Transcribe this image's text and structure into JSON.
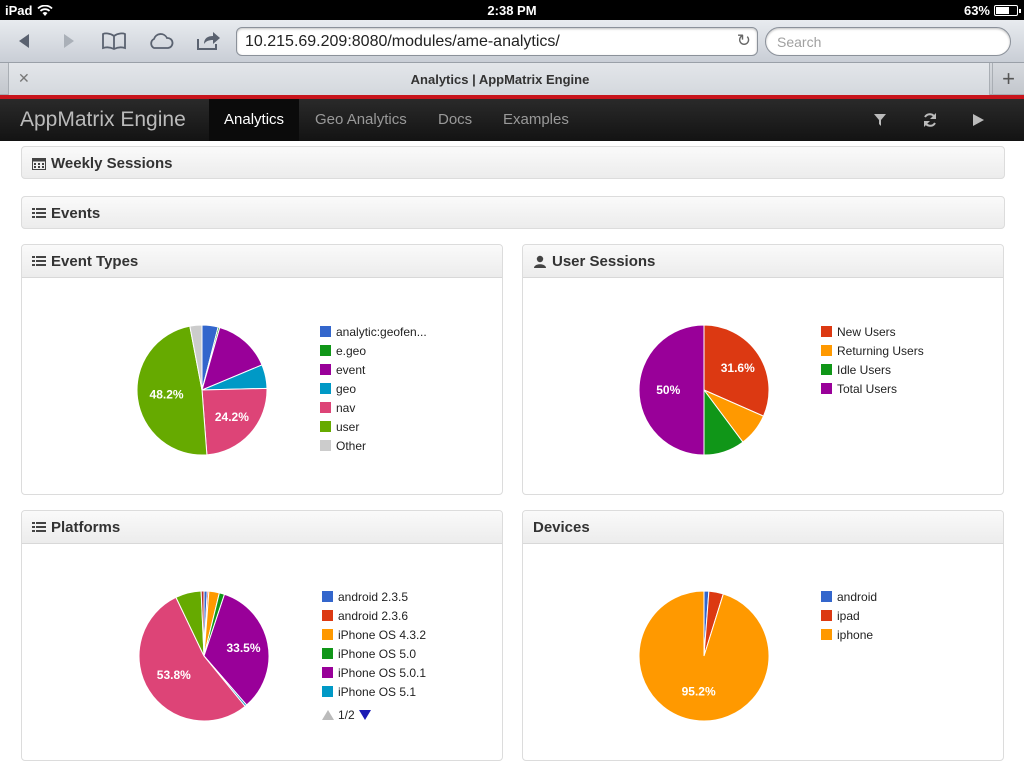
{
  "status": {
    "device": "iPad",
    "time": "2:38 PM",
    "battery": "63%",
    "battery_level": 0.63
  },
  "browser": {
    "url": "10.215.69.209:8080/modules/ame-analytics/",
    "search_placeholder": "Search",
    "tab_title": "Analytics | AppMatrix Engine"
  },
  "app": {
    "brand": "AppMatrix Engine",
    "nav": [
      "Analytics",
      "Geo Analytics",
      "Docs",
      "Examples"
    ],
    "active_nav": "Analytics"
  },
  "panels": {
    "weekly_sessions": "Weekly Sessions",
    "events": "Events",
    "event_types": "Event Types",
    "user_sessions": "User Sessions",
    "platforms": "Platforms",
    "devices": "Devices"
  },
  "pager": {
    "label": "1/2"
  },
  "chart_data": [
    {
      "type": "pie",
      "title": "Event Types",
      "labels": [
        "analytic:geofen...",
        "e.geo",
        "event",
        "geo",
        "nav",
        "user",
        "Other"
      ],
      "values": [
        4.0,
        0.4,
        14.3,
        5.9,
        24.2,
        48.2,
        3.0
      ],
      "colors": [
        "#3366cc",
        "#109618",
        "#990099",
        "#0099c6",
        "#dd4477",
        "#66aa00",
        "#cccccc"
      ],
      "slice_labels": [
        "",
        "",
        "",
        "",
        "24.2%",
        "48.2%",
        ""
      ]
    },
    {
      "type": "pie",
      "title": "User Sessions",
      "labels": [
        "New Users",
        "Returning Users",
        "Idle Users",
        "Total Users"
      ],
      "values": [
        31.6,
        8.2,
        10.2,
        50.0
      ],
      "colors": [
        "#dc3912",
        "#ff9900",
        "#109618",
        "#990099"
      ],
      "slice_labels": [
        "31.6%",
        "",
        "",
        "50%"
      ]
    },
    {
      "type": "pie",
      "title": "Platforms",
      "labels": [
        "android 2.3.5",
        "android 2.3.6",
        "iPhone OS 4.3.2",
        "iPhone OS 5.0",
        "iPhone OS 5.0.1",
        "iPhone OS 5.1"
      ],
      "values": [
        0.8,
        0.4,
        2.6,
        1.3,
        33.5,
        0.5,
        53.8,
        6.4,
        0.7
      ],
      "colors": [
        "#3366cc",
        "#dc3912",
        "#ff9900",
        "#109618",
        "#990099",
        "#0099c6",
        "#dd4477",
        "#66aa00",
        "#b82e2e"
      ],
      "slice_labels": [
        "",
        "",
        "",
        "",
        "33.5%",
        "",
        "53.8%",
        "",
        ""
      ]
    },
    {
      "type": "pie",
      "title": "Devices",
      "labels": [
        "android",
        "ipad",
        "iphone"
      ],
      "values": [
        1.2,
        3.6,
        95.2
      ],
      "colors": [
        "#3366cc",
        "#dc3912",
        "#ff9900"
      ],
      "slice_labels": [
        "",
        "",
        "95.2%"
      ]
    }
  ]
}
